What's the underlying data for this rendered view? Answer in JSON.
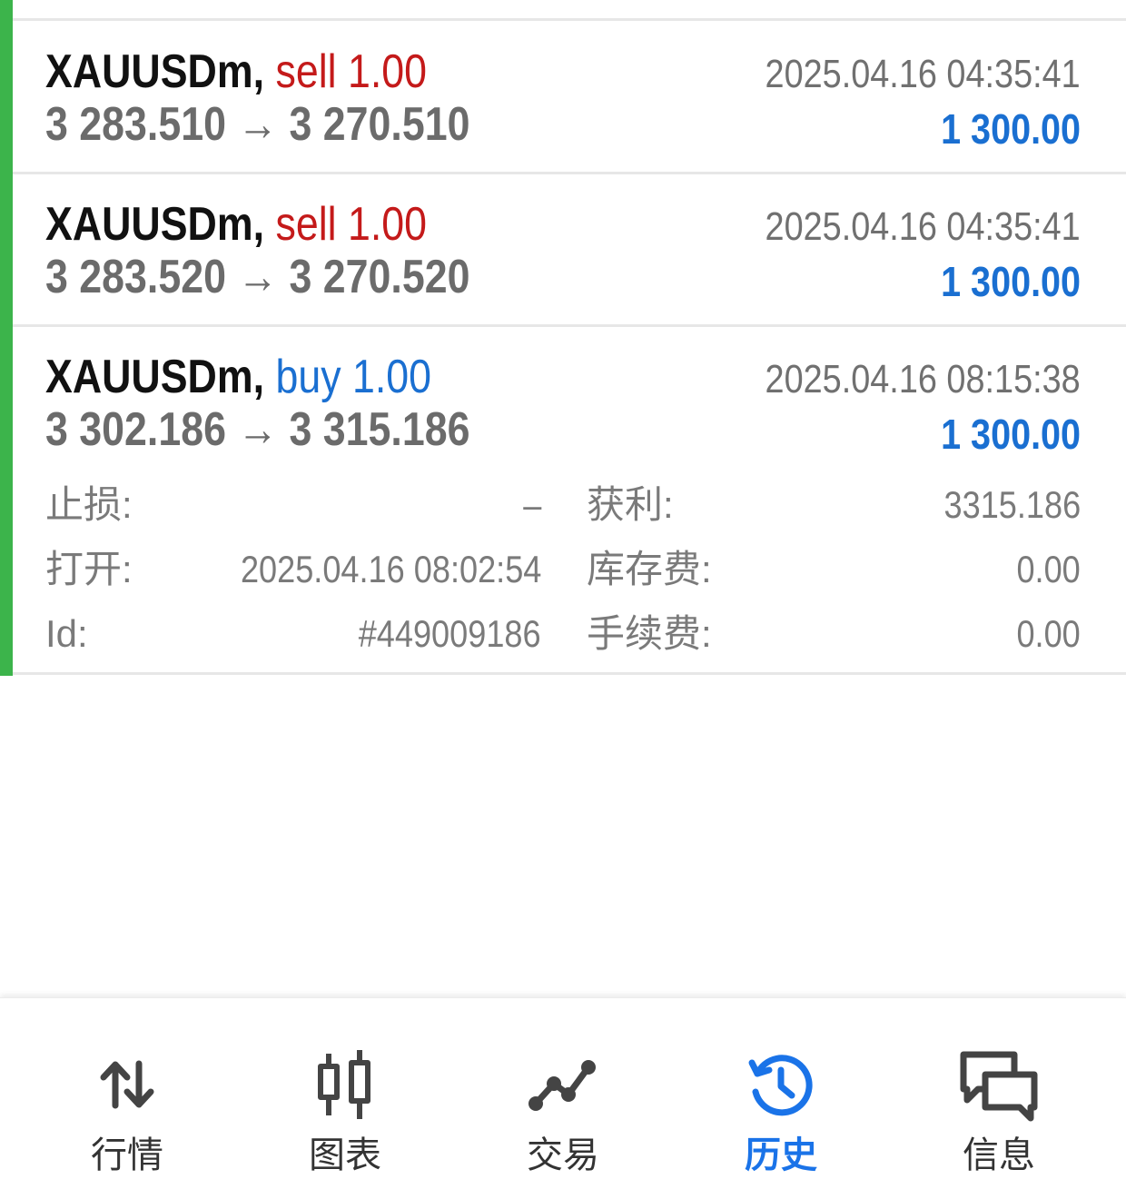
{
  "deals": [
    {
      "symbol": "XAUUSDm,",
      "direction": "sell",
      "volume_text": "sell 1.00",
      "prices": "3 283.510 → 3 270.510",
      "time": "2025.04.16 04:35:41",
      "profit": "1 300.00"
    },
    {
      "symbol": "XAUUSDm,",
      "direction": "sell",
      "volume_text": "sell 1.00",
      "prices": "3 283.520 → 3 270.520",
      "time": "2025.04.16 04:35:41",
      "profit": "1 300.00"
    },
    {
      "symbol": "XAUUSDm,",
      "direction": "buy",
      "volume_text": "buy 1.00",
      "prices": "3 302.186 → 3 315.186",
      "time": "2025.04.16 08:15:38",
      "profit": "1 300.00"
    }
  ],
  "details": {
    "sl_label": "止损:",
    "sl_value": "–",
    "tp_label": "获利:",
    "tp_value": "3315.186",
    "open_label": "打开:",
    "open_value": "2025.04.16 08:02:54",
    "swap_label": "库存费:",
    "swap_value": "0.00",
    "id_label": "Id:",
    "id_value": "#449009186",
    "commission_label": "手续费:",
    "commission_value": "0.00"
  },
  "nav": [
    {
      "label": "行情",
      "icon": "quotes-arrows-icon",
      "active": false
    },
    {
      "label": "图表",
      "icon": "candlestick-chart-icon",
      "active": false
    },
    {
      "label": "交易",
      "icon": "trade-line-icon",
      "active": false
    },
    {
      "label": "历史",
      "icon": "history-clock-icon",
      "active": true
    },
    {
      "label": "信息",
      "icon": "messages-chat-icon",
      "active": false
    }
  ],
  "colors": {
    "accent_green": "#3cb44b",
    "sell_red": "#c41a1a",
    "buy_blue": "#1a6fd1",
    "active_nav": "#1a73e8"
  }
}
